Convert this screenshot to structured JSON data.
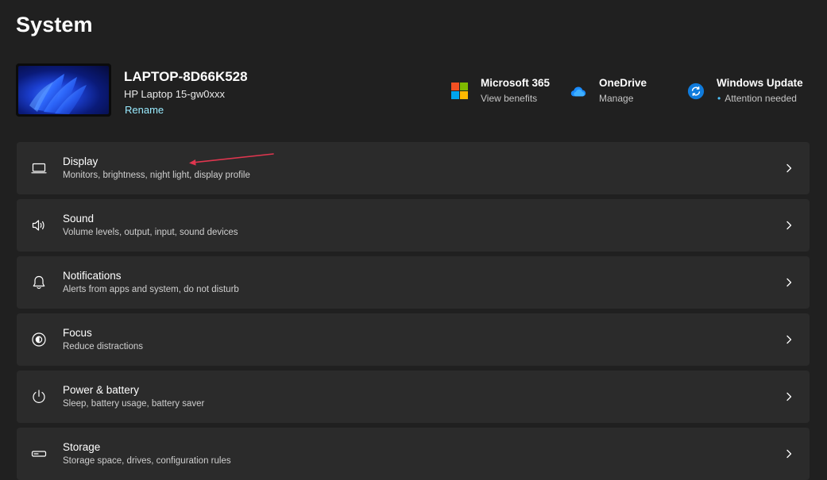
{
  "page": {
    "title": "System"
  },
  "device": {
    "name": "LAPTOP-8D66K528",
    "model": "HP Laptop 15-gw0xxx",
    "rename_label": "Rename"
  },
  "quick_links": {
    "ms365": {
      "title": "Microsoft 365",
      "subtitle": "View benefits",
      "icon": "microsoft-365-icon"
    },
    "onedrive": {
      "title": "OneDrive",
      "subtitle": "Manage",
      "icon": "onedrive-cloud-icon"
    },
    "windows_update": {
      "title": "Windows Update",
      "subtitle": "Attention needed",
      "status_dot": "•",
      "icon": "windows-update-icon"
    }
  },
  "settings": [
    {
      "title": "Display",
      "description": "Monitors, brightness, night light, display profile",
      "icon": "monitor-icon"
    },
    {
      "title": "Sound",
      "description": "Volume levels, output, input, sound devices",
      "icon": "speaker-icon"
    },
    {
      "title": "Notifications",
      "description": "Alerts from apps and system, do not disturb",
      "icon": "bell-icon"
    },
    {
      "title": "Focus",
      "description": "Reduce distractions",
      "icon": "focus-icon"
    },
    {
      "title": "Power & battery",
      "description": "Sleep, battery usage, battery saver",
      "icon": "power-icon"
    },
    {
      "title": "Storage",
      "description": "Storage space, drives, configuration rules",
      "icon": "storage-drive-icon"
    }
  ],
  "colors": {
    "background": "#202020",
    "card": "#2b2b2b",
    "link": "#99ebff",
    "accent": "#4cc2ff",
    "annotation_arrow": "#e0364f"
  }
}
